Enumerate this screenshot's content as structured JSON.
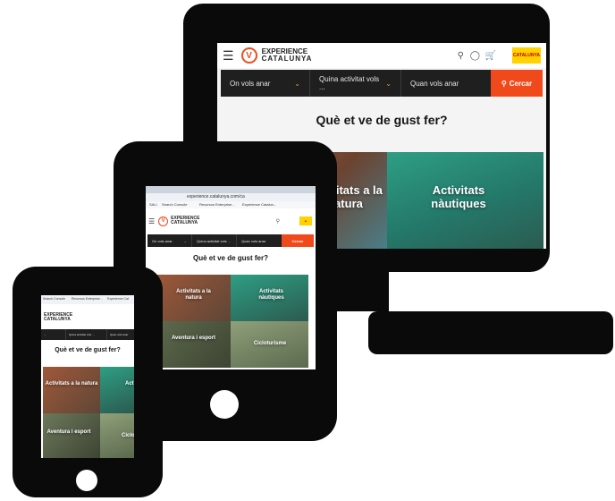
{
  "brand": {
    "name_line1": "EXPERIENCE",
    "name_line2": "CATALUNYA",
    "badge": "CATALUNYA"
  },
  "search": {
    "where": "On vols anar",
    "activity": "Quina activitat vols ...",
    "when": "Quan vols anar",
    "button": "Cercar"
  },
  "heading": "Què et ve de gust fer?",
  "tiles": [
    {
      "label": "Activitats a la natura",
      "color": "#8b5a3c"
    },
    {
      "label": "Activitats nàutiques",
      "color": "#2f8f78"
    },
    {
      "label": "Aventura i esport",
      "color": "#5f6b4d"
    },
    {
      "label": "Cicloturisme",
      "color": "#7a8f6a"
    }
  ],
  "browser": {
    "url": "experience.catalunya.com/ca",
    "bookmarks": [
      "SALI",
      "Search Console",
      "Recursos Enterprise...",
      "Experience Catalun..."
    ],
    "mobile_bookmarks": [
      "Search Console",
      "Recursos Enterprise...",
      "Experience Cat"
    ]
  },
  "colors": {
    "accent": "#f04a1c",
    "device": "#0a0a0a",
    "search_bg": "#1f1f1f"
  }
}
